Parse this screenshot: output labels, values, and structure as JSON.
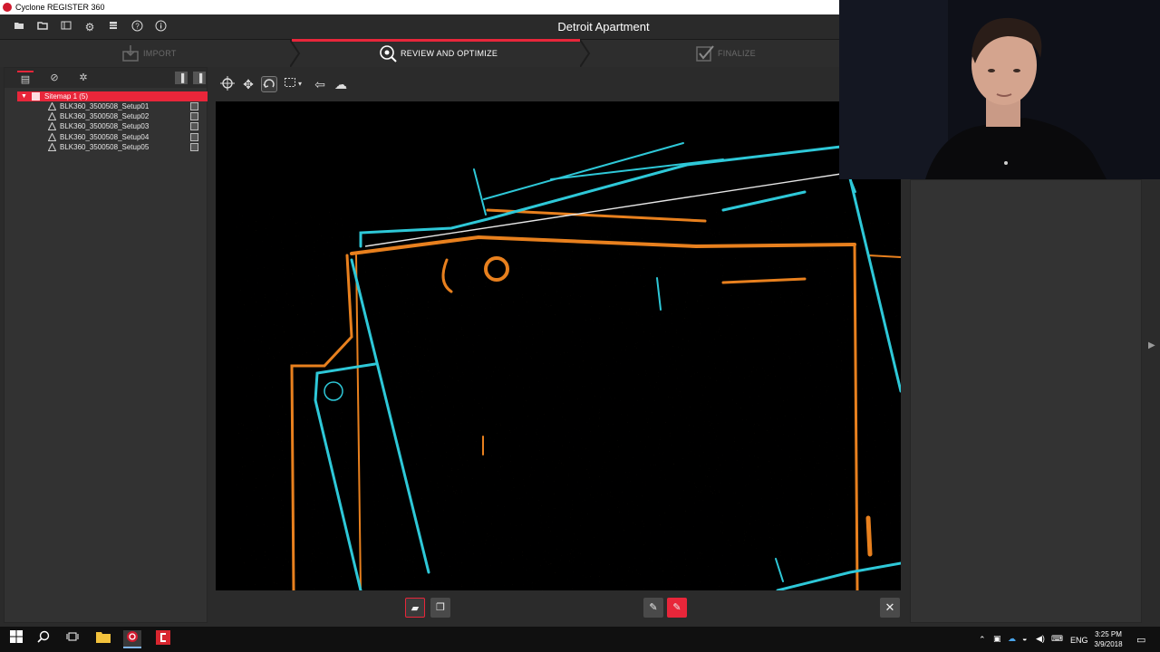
{
  "window": {
    "title": "Cyclone REGISTER 360"
  },
  "toolbar": {
    "project_title": "Detroit Apartment",
    "icons": [
      "folder-open-icon",
      "folder-icon",
      "layers-icon",
      "gear-icon",
      "database-icon",
      "help-icon",
      "info-icon"
    ]
  },
  "workflow": {
    "steps": [
      {
        "label": "IMPORT",
        "state": "disabled"
      },
      {
        "label": "REVIEW AND OPTIMIZE",
        "state": "active"
      },
      {
        "label": "FINALIZE",
        "state": "disabled"
      }
    ],
    "accent_color": "#e8263a"
  },
  "sidebar": {
    "tabs": [
      "list-view-icon",
      "link-icon",
      "network-icon"
    ],
    "tree": {
      "root_label": "Sitemap 1 (5)",
      "items": [
        {
          "label": "BLK360_3500508_Setup01"
        },
        {
          "label": "BLK360_3500508_Setup02"
        },
        {
          "label": "BLK360_3500508_Setup03"
        },
        {
          "label": "BLK360_3500508_Setup04"
        },
        {
          "label": "BLK360_3500508_Setup05"
        }
      ]
    }
  },
  "viewport": {
    "tools": [
      "orbit-icon",
      "pan-icon",
      "rotate-icon",
      "select-box-icon",
      "back-icon",
      "cloud-icon"
    ],
    "colors": {
      "cloud_a": "#2ec8d8",
      "cloud_b": "#e8801e",
      "link_line": "#e6e6e6"
    }
  },
  "bottom_bar": {
    "buttons": [
      "layer-icon",
      "copy-icon",
      "pen-icon",
      "pen-active-icon",
      "close-icon"
    ]
  },
  "taskbar": {
    "apps": [
      "windows-start-icon",
      "search-icon",
      "task-view-icon",
      "file-explorer-icon",
      "cyclone-app-icon",
      "cyclone-core-icon"
    ],
    "language": "ENG",
    "time": "3:25 PM",
    "date": "3/9/2018"
  }
}
